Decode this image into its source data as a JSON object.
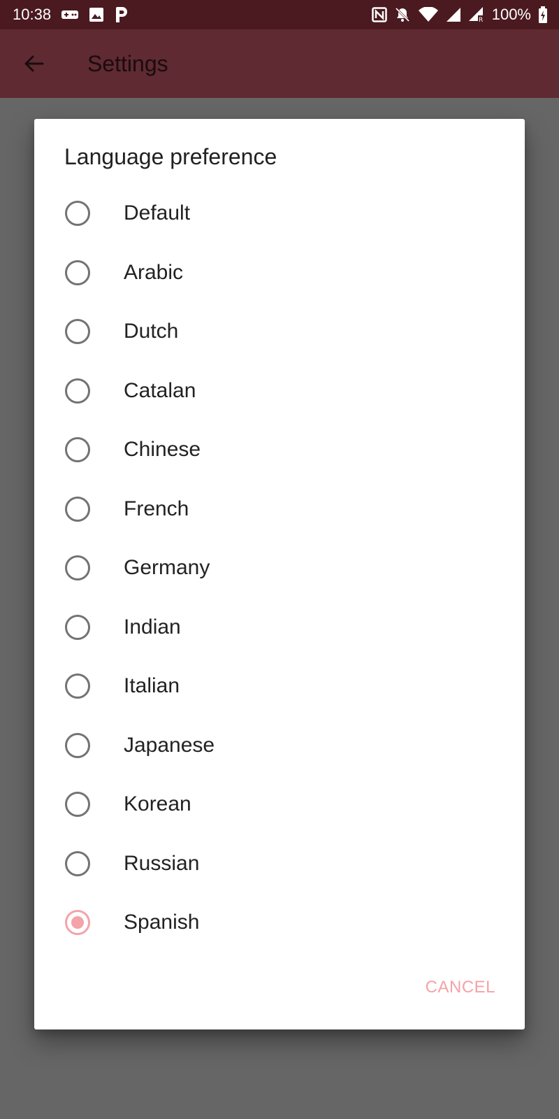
{
  "status_bar": {
    "time": "10:38",
    "battery": "100%",
    "icons_left": [
      "gamepad-icon",
      "image-icon",
      "p-app-icon"
    ],
    "icons_right": [
      "nfc-icon",
      "bell-off-icon",
      "wifi-icon",
      "signal-icon",
      "signal-roaming-icon",
      "battery-charging-icon"
    ]
  },
  "app_bar": {
    "title": "Settings",
    "back_icon": "arrow-back-icon"
  },
  "dialog": {
    "title": "Language preference",
    "options": [
      {
        "label": "Default",
        "selected": false
      },
      {
        "label": "Arabic",
        "selected": false
      },
      {
        "label": "Dutch",
        "selected": false
      },
      {
        "label": "Catalan",
        "selected": false
      },
      {
        "label": "Chinese",
        "selected": false
      },
      {
        "label": "French",
        "selected": false
      },
      {
        "label": "Germany",
        "selected": false
      },
      {
        "label": "Indian",
        "selected": false
      },
      {
        "label": "Italian",
        "selected": false
      },
      {
        "label": "Japanese",
        "selected": false
      },
      {
        "label": "Korean",
        "selected": false
      },
      {
        "label": "Russian",
        "selected": false
      },
      {
        "label": "Spanish",
        "selected": true
      }
    ],
    "cancel_label": "CANCEL"
  },
  "colors": {
    "accent": "#f4a3a8",
    "status_bar": "#4a1a20",
    "app_bar_dimmed": "#5f2a31",
    "scrim": "#666666"
  }
}
